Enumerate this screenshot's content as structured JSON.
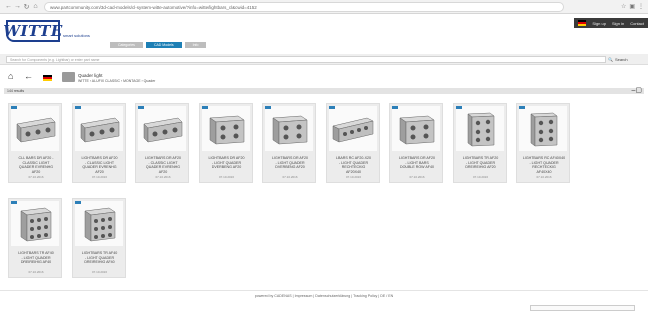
{
  "browser": {
    "url": "www.partcommunity.com/3d-cad-models/cl-system-witte-automotive/?info=witte/lightbars_cl&cwid=4152",
    "nav_icons": [
      "back-icon",
      "forward-icon",
      "reload-icon",
      "home-icon"
    ],
    "right_icons": [
      "star-icon",
      "extensions-icon",
      "menu-icon"
    ]
  },
  "header": {
    "logo_text": "WITTE",
    "logo_sub": "smart solutions",
    "top_links": [
      "Sign up",
      "Sign in",
      "Contact"
    ],
    "tabs": [
      {
        "label": "Categories",
        "active": false
      },
      {
        "label": "CAD Models",
        "active": true
      },
      {
        "label": "Info",
        "active": false
      }
    ]
  },
  "search": {
    "placeholder": "Search for Components (e.g. Lightbar) or enter part name",
    "button_label": "Search"
  },
  "toolbar": {
    "icons": [
      "home-icon",
      "back-icon"
    ],
    "title": "Quader light",
    "path": "WITTE › ALUFIX CLASSIC › MONTAGE › Quader"
  },
  "results": {
    "label": "144 results",
    "icons": [
      "minimize-icon",
      "window-icon"
    ]
  },
  "cards": [
    {
      "title": "CLL BARS DR AF20 -\nCLASSIC LIGHT\nQUADER EVRENHG\nAF20",
      "date": "07.10.2016",
      "shape": "bar3"
    },
    {
      "title": "LIGHTBARS DR AF20\n- CLASSIC LIGHT\nQUADER EVRENHG\nAF20",
      "date": "07.10.2016",
      "shape": "bar3"
    },
    {
      "title": "LIGHTBARS DR AF20\n- CLASSIC LIGHT\nQUADER EVRENHG\nAF20",
      "date": "07.10.2016",
      "shape": "bar3"
    },
    {
      "title": "LIGHTBARS DR AF20\n- LIGHT QUADER\nDVERBENG AF20",
      "date": "07.10.2016",
      "shape": "box"
    },
    {
      "title": "LIGHTBARS DR AF20\n- LIGHT QUADER\nDVERBENG AF20",
      "date": "07.10.2016",
      "shape": "box"
    },
    {
      "title": "LBARS RC AF20-X20\n- LIGHT QUADER\nRECHTECKIG\nAF20X40",
      "date": "07.10.2016",
      "shape": "long"
    },
    {
      "title": "LIGHTBARS DR AF20\n- LIGHT BARS\nDOUBLE ROW AF40",
      "date": "07.10.2016",
      "shape": "box"
    },
    {
      "title": "LIGHTBARS TR AF20\n- LIGHT QUADER\nDREIREIHIG AF20",
      "date": "07.10.2016",
      "shape": "tall"
    },
    {
      "title": "LIGHTBARS RC AF40X40\n- LIGHT QUADER\nRECHTECKIG\nAF40X40",
      "date": "07.10.2016",
      "shape": "tall"
    },
    {
      "title": "LIGHTBARS TR AF40\n- LIGHT QUADER\nDREIREIHIG AF40",
      "date": "07.10.2016",
      "shape": "cube"
    },
    {
      "title": "LIGHTBARS TR AF40\n- LIGHT QUADER\nDREIREIHIG AF40",
      "date": "07.10.2016",
      "shape": "cube"
    }
  ],
  "footer": {
    "text": "powered by CADENAS  |  Impressum  |  Datenschutzerklärung  |  Tracking Policy  |  DE / EN"
  }
}
